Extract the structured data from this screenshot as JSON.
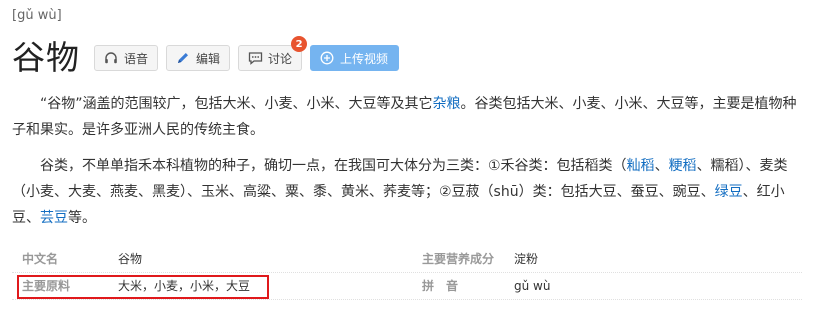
{
  "entry": {
    "pinyin": "[gǔ wù]",
    "title": "谷物"
  },
  "toolbar": {
    "voice_label": "语音",
    "edit_label": "编辑",
    "discuss_label": "讨论",
    "discuss_badge": "2",
    "upload_label": "上传视频"
  },
  "summary": {
    "p1_part1": "“谷物”涵盖的范围较广，包括大米、小麦、小米、大豆等及其它",
    "p1_link": "杂粮",
    "p1_part2": "。谷类包括大米、小麦、小米、大豆等，主要是植物种子和果实。是许多亚洲人民的传统主食。",
    "p2_part1": "谷类，不单单指禾本科植物的种子，确切一点，在我国可大体分为三类：①禾谷类：包括稻类（",
    "p2_link1": "籼稻",
    "p2_sep1": "、",
    "p2_link2": "粳稻",
    "p2_part2": "、糯稻）、麦类（小麦、大麦、燕麦、黑麦）、玉米、高粱、粟、黍、黄米、荞麦等；②豆菽（shū）类：包括大豆、蚕豆、豌豆、",
    "p2_link3": "绿豆",
    "p2_part3": "、红小豆、",
    "p2_link4": "芸豆",
    "p2_part4": "等。"
  },
  "infobox": {
    "rows": [
      {
        "key1": "中文名",
        "value1": "谷物",
        "key2": "主要营养成分",
        "value2": "淀粉"
      },
      {
        "key1": "主要原料",
        "value1": "大米，小麦，小米，大豆",
        "key2": "拼　音",
        "value2": "gǔ wù"
      }
    ]
  },
  "colors": {
    "link": "#136ec2",
    "upload_button": "#75b4f0",
    "badge": "#e8542f",
    "highlight_border": "#e0191c"
  },
  "icons": {
    "voice": "headphones-icon",
    "edit": "pencil-icon",
    "discuss": "chat-icon",
    "upload": "plus-circle-icon"
  }
}
